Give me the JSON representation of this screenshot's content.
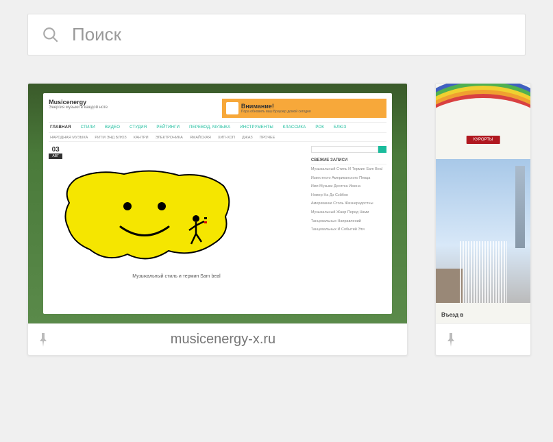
{
  "search": {
    "placeholder": "Поиск"
  },
  "tiles": [
    {
      "label": "musicenergy-x.ru",
      "thumb": {
        "site_name": "Musicenergy",
        "site_tag": "Энергия музыки в каждой ноте",
        "ad_title": "Внимание!",
        "ad_sub": "Пора обновить ваш Браузер домой сегодня",
        "nav": [
          "ГЛАВНАЯ",
          "СТИЛИ",
          "ВИДЕО",
          "СТУДИЯ",
          "РЕЙТИНГИ",
          "ПЕРЕВОД, МУЗЫКА",
          "ИНСТРУМЕНТЫ",
          "КЛАССИКА",
          "РОК",
          "БЛЮЗ"
        ],
        "subnav": [
          "НАРОДНАЯ МУЗЫКА",
          "РИТМ ЭНД БЛЮЗ",
          "КАНТРИ",
          "ЭЛЕКТРОНИКА",
          "ЯМАЙСКАЯ",
          "ХИП-ХОП",
          "ДЖАЗ",
          "ПРОЧЕЕ"
        ],
        "date_num": "03",
        "date_mon": "АВГ",
        "caption": "Музыкальный стиль и термин Sam beal",
        "side_title": "СВЕЖИЕ ЗАПИСИ",
        "side_items": [
          "Музыкальный Стиль И Термин Sam Beal",
          "Известного Американского Певца",
          "Имя Музыки Десятка Имена",
          "Номер На Дэ Сэйбон",
          "Американки Столь Жизнерадостны",
          "Музыкальный Жанр Перед Нами",
          "Танцевальных Направлений",
          "Танцевальных И Событий Эти"
        ]
      }
    },
    {
      "label": "",
      "thumb": {
        "btn_label": "КУРОРТЫ",
        "caption": "Въезд в"
      }
    }
  ]
}
